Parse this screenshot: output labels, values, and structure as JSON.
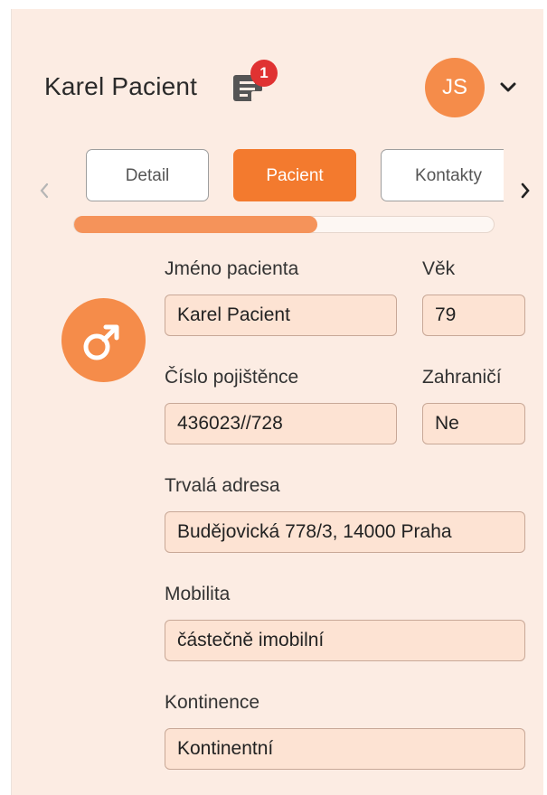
{
  "header": {
    "title": "Karel Pacient",
    "notes_badge": "1",
    "avatar_initials": "JS"
  },
  "tabs": [
    {
      "label": "Detail",
      "active": false
    },
    {
      "label": "Pacient",
      "active": true
    },
    {
      "label": "Kontakty",
      "active": false
    }
  ],
  "progress": {
    "fraction": 0.58
  },
  "form": {
    "name_label": "Jméno pacienta",
    "name_value": "Karel Pacient",
    "age_label": "Věk",
    "age_value": "79",
    "insurance_label": "Číslo pojištěnce",
    "insurance_value": "436023//728",
    "foreign_label": "Zahraničí",
    "foreign_value": "Ne",
    "address_label": "Trvalá adresa",
    "address_value": "Budějovická 778/3, 14000 Praha",
    "mobility_label": "Mobilita",
    "mobility_value": "částečně imobilní",
    "continence_label": "Kontinence",
    "continence_value": "Kontinentní"
  },
  "icons": {
    "notes": "notes-icon",
    "gender": "male-icon",
    "menu": "chevron-down-icon",
    "prev": "chevron-left-icon",
    "next": "chevron-right-icon"
  },
  "colors": {
    "accent": "#f37a2e",
    "background": "#fcece3",
    "field_bg": "#fde3d3",
    "badge": "#e03232"
  }
}
